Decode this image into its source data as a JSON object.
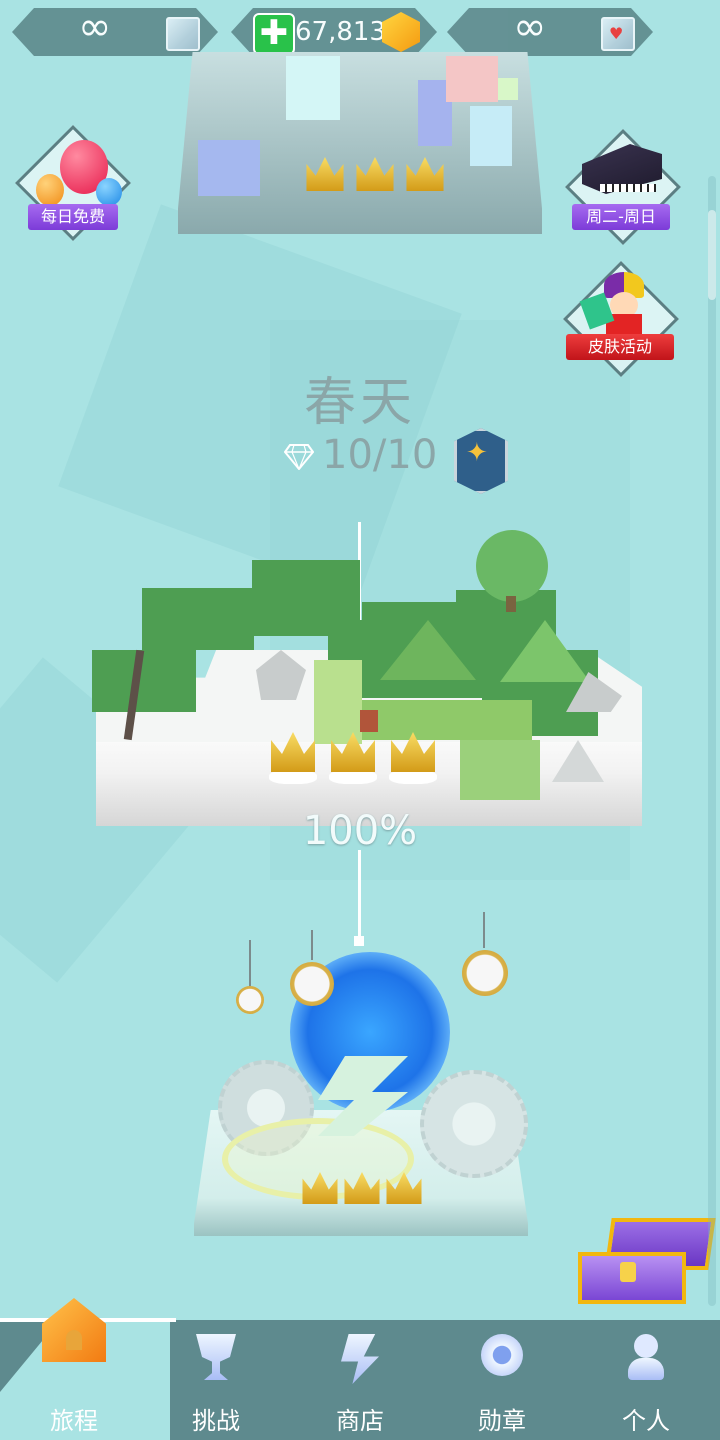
{
  "top_bar": {
    "left_value": "∞",
    "coins_value": "67,813",
    "right_value": "∞",
    "plus_symbol": "✚"
  },
  "side_badges": {
    "daily_free": "每日免费",
    "piano_days": "周二-周日",
    "skin_event": "皮肤活动"
  },
  "level": {
    "name": "春天",
    "gems": "10/10",
    "progress": "100%",
    "progress_value": 100
  },
  "nav": {
    "items": [
      {
        "label": "旅程",
        "icon": "house-icon"
      },
      {
        "label": "挑战",
        "icon": "trophy-icon"
      },
      {
        "label": "商店",
        "icon": "shop-icon"
      },
      {
        "label": "勋章",
        "icon": "medal-icon"
      },
      {
        "label": "个人",
        "icon": "person-icon"
      }
    ]
  },
  "colors": {
    "background": "#a9e3e3",
    "nav_bar": "#5e8a8e",
    "accent_green": "#29c24a",
    "badge_purple": "#7c3bd8",
    "badge_red": "#c1141a"
  }
}
